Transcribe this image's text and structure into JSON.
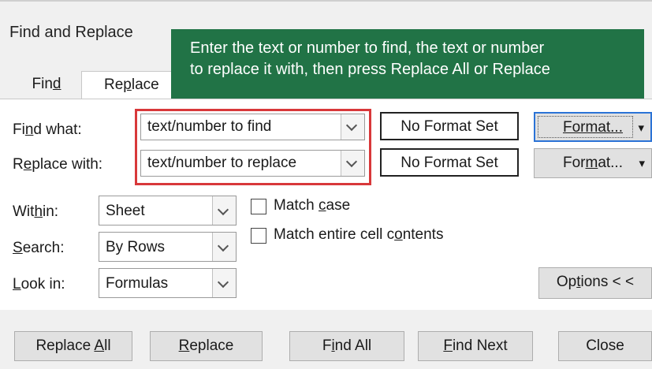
{
  "dialog": {
    "title": "Find and Replace"
  },
  "callout": {
    "line1": "Enter the text or number to find, the text or number",
    "line2": "to replace it with, then press Replace All or Replace",
    "color": "#217346"
  },
  "tabs": {
    "find": {
      "pre": "Fin",
      "u": "d",
      "post": ""
    },
    "replace": {
      "pre": "Re",
      "u": "p",
      "post": "lace"
    }
  },
  "find_what": {
    "pre": "Fi",
    "u": "n",
    "post": "d what:",
    "value": "text/number to find",
    "format_status": "No Format Set"
  },
  "replace_with": {
    "pre": "R",
    "u": "e",
    "post": "place with:",
    "value": "text/number to replace",
    "format_status": "No Format Set"
  },
  "format_buttons": {
    "find": {
      "pre": "Format...",
      "u": "",
      "post": ""
    },
    "replace": {
      "pre": "For",
      "u": "m",
      "post": "at..."
    }
  },
  "within": {
    "pre": "Wit",
    "u": "h",
    "post": "in:",
    "value": "Sheet"
  },
  "search": {
    "pre": "",
    "u": "S",
    "post": "earch:",
    "value": "By Rows"
  },
  "look_in": {
    "pre": "",
    "u": "L",
    "post": "ook in:",
    "value": "Formulas"
  },
  "options": {
    "match_case": {
      "pre": "Match ",
      "u": "c",
      "post": "ase",
      "checked": false
    },
    "match_entire": {
      "pre": "Match entire cell c",
      "u": "o",
      "post": "ntents",
      "checked": false
    }
  },
  "options_button": {
    "pre": "Op",
    "u": "t",
    "post": "ions < <"
  },
  "buttons": {
    "replace_all": {
      "pre": "Replace ",
      "u": "A",
      "post": "ll"
    },
    "replace": {
      "pre": "",
      "u": "R",
      "post": "eplace"
    },
    "find_all": {
      "pre": "F",
      "u": "i",
      "post": "nd All"
    },
    "find_next": {
      "pre": "",
      "u": "F",
      "post": "ind Next"
    },
    "close": {
      "label": "Close"
    }
  },
  "colors": {
    "highlight_border": "#d8383a",
    "focus_border": "#2b73d6"
  }
}
